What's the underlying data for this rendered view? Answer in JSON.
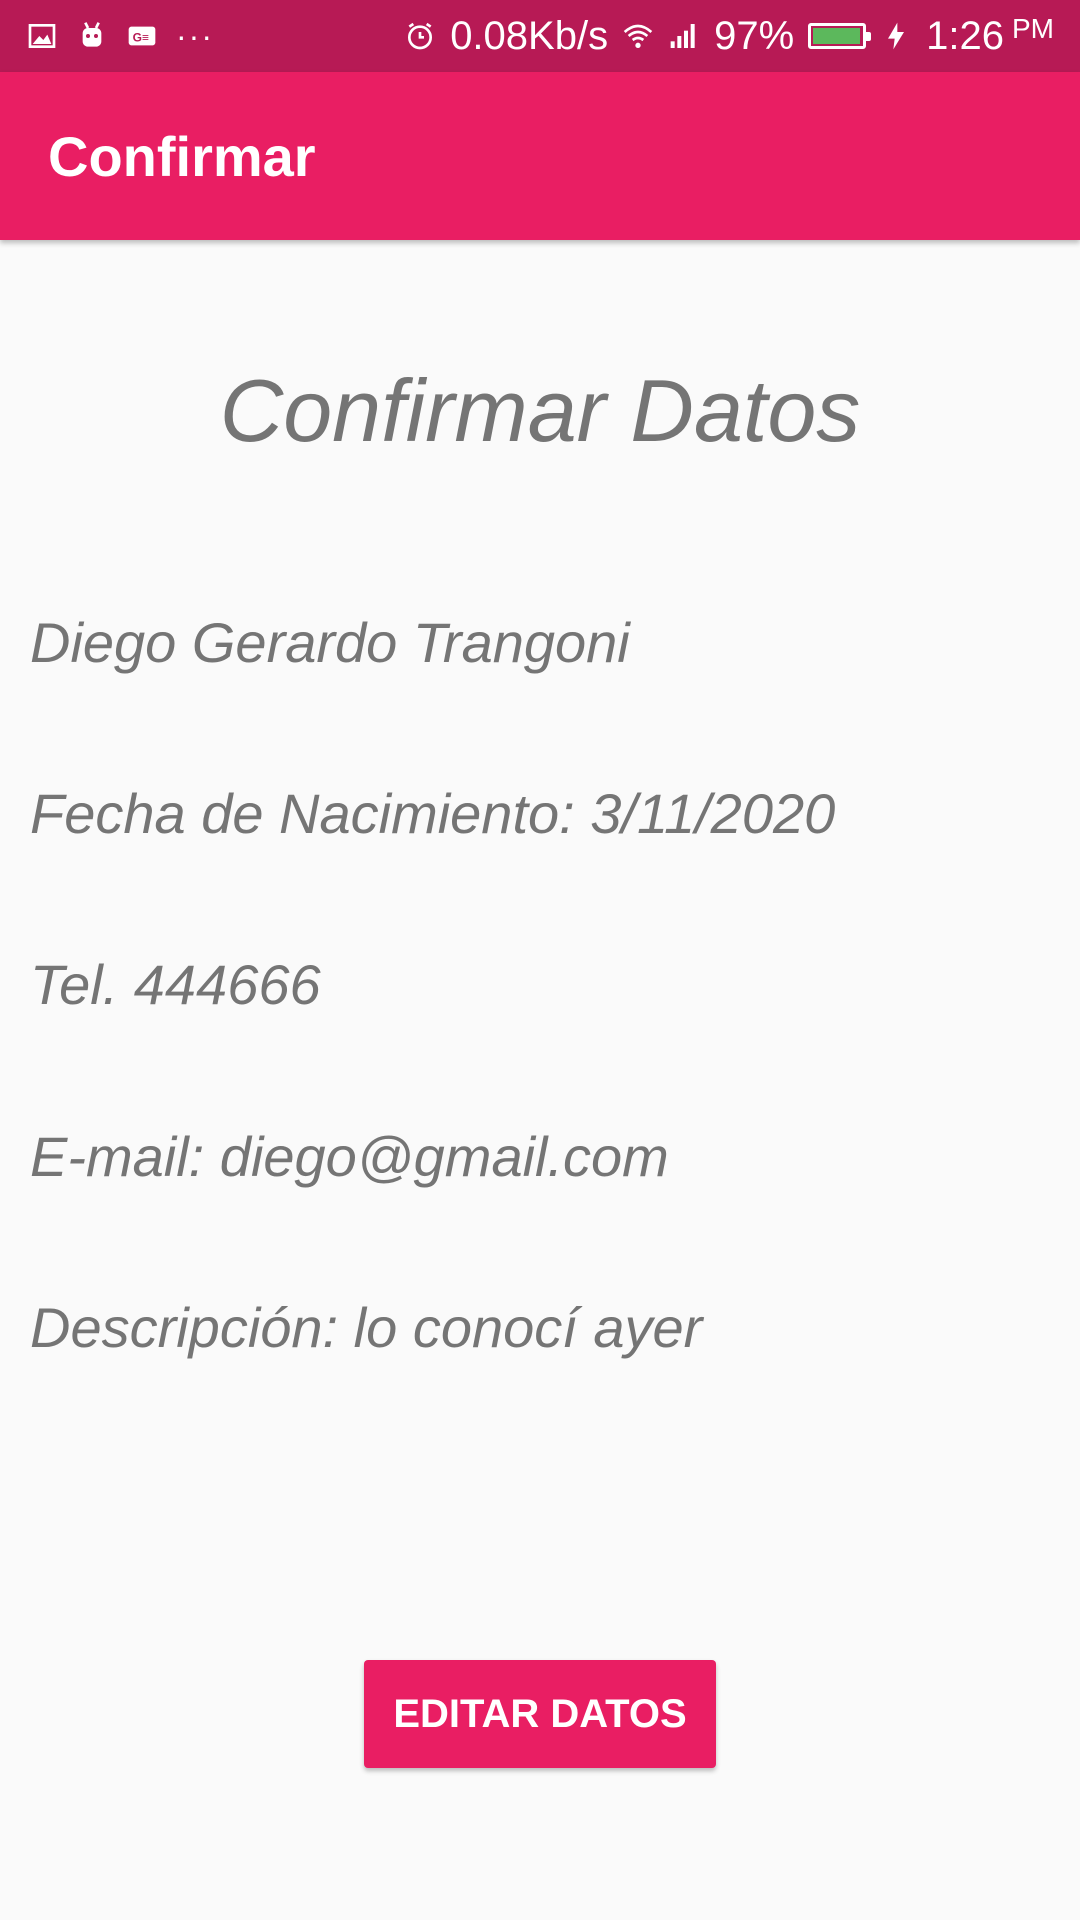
{
  "status_bar": {
    "left_icons": [
      "image-icon",
      "android-icon",
      "ge-icon"
    ],
    "overflow": "···",
    "network_speed": "0.08Kb/s",
    "battery_percent": "97%",
    "battery_level": 0.97,
    "time": "1:26",
    "ampm": "PM"
  },
  "app_bar": {
    "title": "Confirmar",
    "color": "#e91e63"
  },
  "main": {
    "heading": "Confirmar Datos",
    "name": "Diego Gerardo Trangoni",
    "birth_date": "Fecha de Nacimiento: 3/11/2020",
    "phone": "Tel. 444666",
    "email": "E-mail: diego@gmail.com",
    "description": "Descripción: lo conocí ayer",
    "edit_button": "EDITAR DATOS"
  }
}
